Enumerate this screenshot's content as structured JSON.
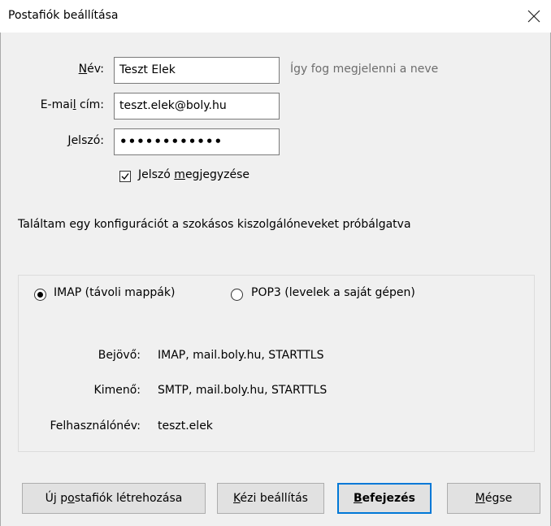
{
  "window": {
    "title": "Postafiók beállítása"
  },
  "form": {
    "name": {
      "label_pre": "",
      "label_key": "N",
      "label_post": "év:",
      "value": "Teszt Elek",
      "hint": "Így fog megjelenni a neve"
    },
    "email": {
      "label_pre": "E-mai",
      "label_key": "l",
      "label_post": " cím:",
      "value": "teszt.elek@boly.hu"
    },
    "password": {
      "label_pre": "",
      "label_key": "J",
      "label_post": "elszó:",
      "value": "••••••••••••"
    },
    "remember": {
      "pre": "Jelszó ",
      "key": "m",
      "post": "egjegyzése",
      "checked": true
    }
  },
  "status_message": "Találtam egy konfigurációt a szokásos kiszolgálóneveket próbálgatva",
  "protocol": {
    "imap_label": "IMAP (távoli mappák)",
    "pop3_label": "POP3 (levelek a saját gépen)",
    "selected": "IMAP"
  },
  "servers": {
    "incoming_label": "Bejövő:",
    "incoming_value": "IMAP, mail.boly.hu, STARTTLS",
    "outgoing_label": "Kimenő:",
    "outgoing_value": "SMTP, mail.boly.hu, STARTTLS",
    "username_label": "Felhasználónév:",
    "username_value": "teszt.elek"
  },
  "buttons": {
    "new_account": {
      "pre": "Új p",
      "key": "o",
      "post": "stafiók létrehozása"
    },
    "manual": {
      "pre": "",
      "key": "K",
      "post": "ézi beállítás"
    },
    "finish": {
      "pre": "",
      "key": "B",
      "post": "efejezés"
    },
    "cancel": {
      "pre": "",
      "key": "M",
      "post": "égse"
    }
  }
}
